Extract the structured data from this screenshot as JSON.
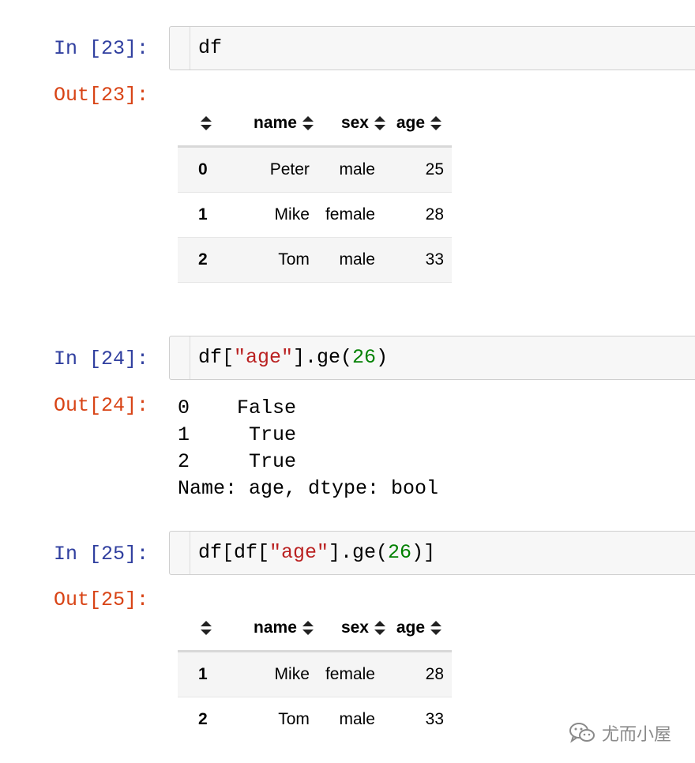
{
  "cells": [
    {
      "in_prompt": "In [23]:",
      "code": "df",
      "out_prompt": "Out[23]:",
      "table": {
        "columns": [
          "name",
          "sex",
          "age"
        ],
        "rows": [
          {
            "index": "0",
            "name": "Peter",
            "sex": "male",
            "age": "25"
          },
          {
            "index": "1",
            "name": "Mike",
            "sex": "female",
            "age": "28"
          },
          {
            "index": "2",
            "name": "Tom",
            "sex": "male",
            "age": "33"
          }
        ]
      }
    },
    {
      "in_prompt": "In [24]:",
      "code_parts": {
        "a": "df[",
        "s": "\"age\"",
        "b": "].ge(",
        "n": "26",
        "c": ")"
      },
      "out_prompt": "Out[24]:",
      "text_output": "0    False\n1     True\n2     True\nName: age, dtype: bool"
    },
    {
      "in_prompt": "In [25]:",
      "code_parts": {
        "a": "df[df[",
        "s": "\"age\"",
        "b": "].ge(",
        "n": "26",
        "c": ")]"
      },
      "out_prompt": "Out[25]:",
      "table": {
        "columns": [
          "name",
          "sex",
          "age"
        ],
        "rows": [
          {
            "index": "1",
            "name": "Mike",
            "sex": "female",
            "age": "28"
          },
          {
            "index": "2",
            "name": "Tom",
            "sex": "male",
            "age": "33"
          }
        ]
      }
    }
  ],
  "watermark": {
    "text": "尤而小屋",
    "icon": "wechat-icon"
  },
  "colors": {
    "in_prompt": "#303F9F",
    "out_prompt": "#D84315",
    "string": "#BA2121",
    "number": "#008000"
  }
}
